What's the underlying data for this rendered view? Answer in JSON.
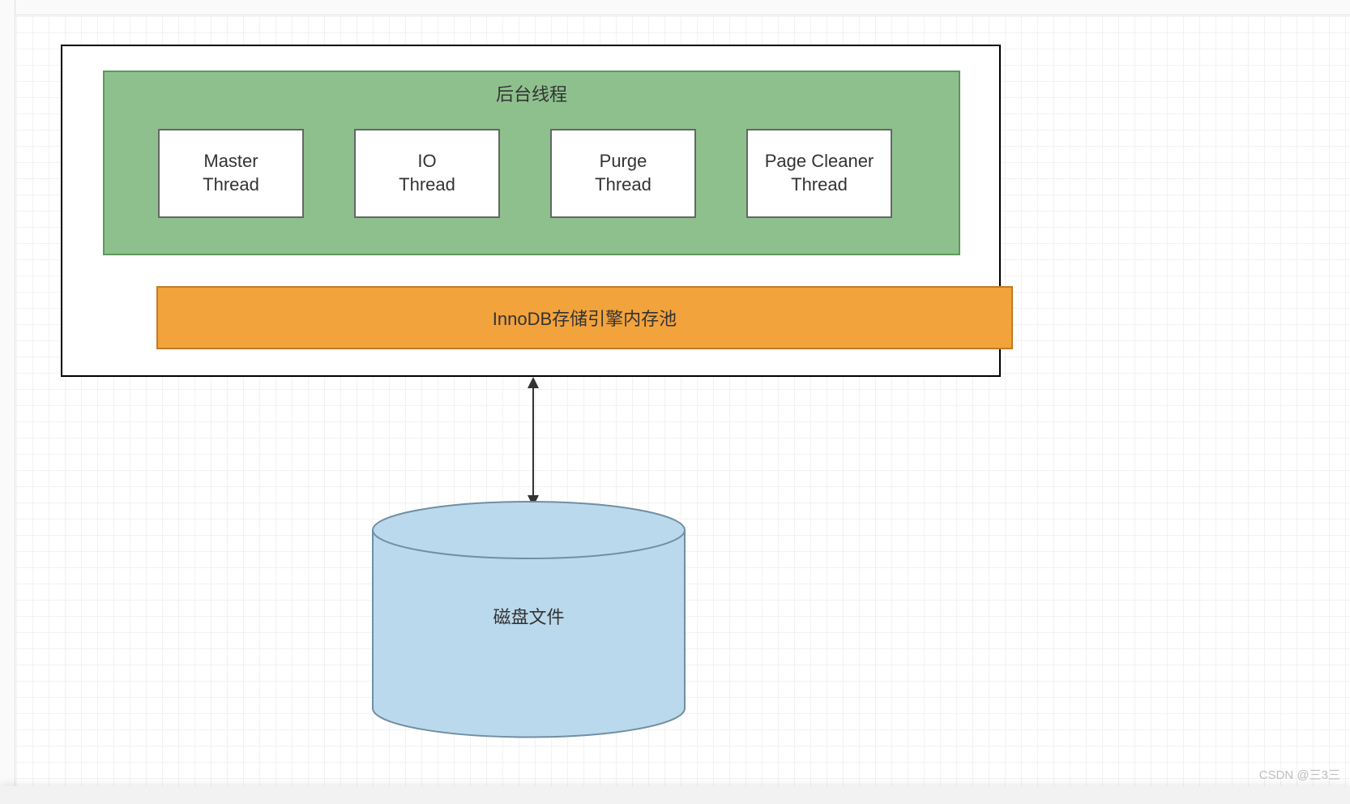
{
  "green_title": "后台线程",
  "threads": {
    "t1": "Master\nThread",
    "t2": "IO\nThread",
    "t3": "Purge\nThread",
    "t4": "Page Cleaner\nThread"
  },
  "memory_pool": "InnoDB存储引擎内存池",
  "disk_label": "磁盘文件",
  "watermark": "CSDN @三3三",
  "colors": {
    "green_fill": "#8ec08e",
    "green_border": "#5a9a5a",
    "orange_fill": "#f2a33c",
    "orange_border": "#c27a1f",
    "cylinder_fill": "#bbd9ec",
    "cylinder_border": "#6f8fa3"
  }
}
